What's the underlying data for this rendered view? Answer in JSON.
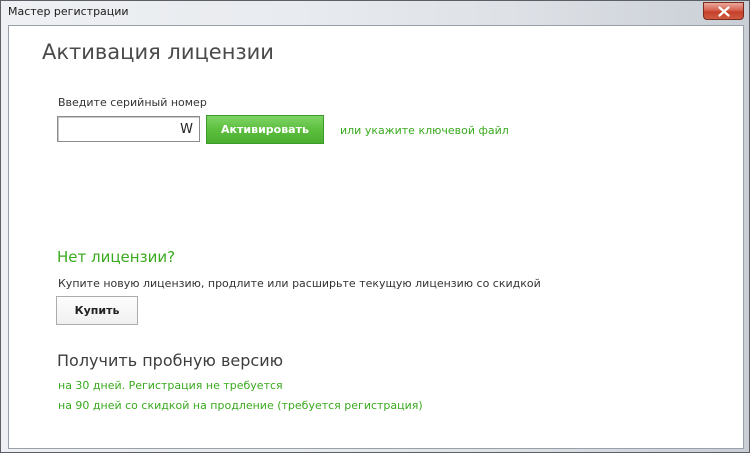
{
  "window": {
    "title": "Мастер регистрации"
  },
  "activation": {
    "heading": "Активация лицензии",
    "serial_label": "Введите серийный номер",
    "serial_value": "W",
    "activate_label": "Активировать",
    "keyfile_link": "или укажите ключевой файл"
  },
  "no_license": {
    "heading": "Нет лицензии?",
    "description": "Купите новую лицензию, продлите или расширьте текущую лицензию со скидкой",
    "buy_label": "Купить"
  },
  "trial": {
    "heading": "Получить пробную версию",
    "links": [
      "на 30 дней. Регистрация не требуется",
      "на 90 дней со скидкой на продление (требуется регистрация)"
    ]
  },
  "colors": {
    "accent_green": "#3aaa1f",
    "button_green": "#5cbf3d",
    "close_red": "#c4402b"
  },
  "icons": {
    "close": "close-icon"
  }
}
